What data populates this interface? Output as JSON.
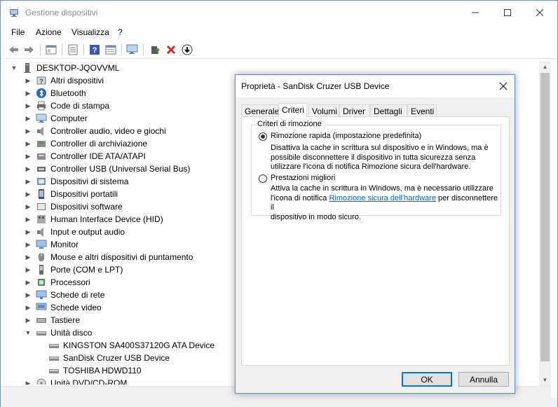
{
  "window": {
    "title": "Gestione dispositivi"
  },
  "menu": [
    "File",
    "Azione",
    "Visualizza",
    "?"
  ],
  "tree": {
    "root": "DESKTOP-JQOVVML",
    "categories": [
      "Altri dispositivi",
      "Bluetooth",
      "Code di stampa",
      "Computer",
      "Controller audio, video e giochi",
      "Controller di archiviazione",
      "Controller IDE ATA/ATAPI",
      "Controller USB (Universal Serial Bus)",
      "Dispositivi di sistema",
      "Dispositivi portatili",
      "Dispositivi software",
      "Human Interface Device (HID)",
      "Input e output audio",
      "Monitor",
      "Mouse e altri dispositivi di puntamento",
      "Porte (COM e LPT)",
      "Processori",
      "Schede di rete",
      "Schede video",
      "Tastiere",
      "Unità disco"
    ],
    "disks": [
      "KINGSTON SA400S37120G ATA Device",
      "SanDisk Cruzer USB Device",
      "TOSHIBA HDWD110"
    ],
    "last": "Unità DVD/CD-ROM"
  },
  "dialog": {
    "title": "Proprietà - SanDisk Cruzer USB Device",
    "tabs": [
      "Generale",
      "Criteri",
      "Volumi",
      "Driver",
      "Dettagli",
      "Eventi"
    ],
    "active_tab": "Criteri",
    "group_title": "Criteri di rimozione",
    "option1": {
      "label": "Rimozione rapida (impostazione predefinita)",
      "desc1": "Disattiva la cache in scrittura sul dispositivo e in Windows, ma è",
      "desc2": "possibile disconnettere il dispositivo in tutta sicurezza senza",
      "desc3": "utilizzare l'icona di notifica Rimozione sicura dell'hardware."
    },
    "option2": {
      "label": "Prestazioni migliori",
      "desc1": "Attiva la cache in scrittura in Windows, ma è necessario utilizzare",
      "desc2a": "l'icona di notifica ",
      "desc2link": "Rimozione sicura dell'hardware",
      "desc2b": " per disconnettere il",
      "desc3": "dispositivo in modo sicuro."
    },
    "ok": "OK",
    "cancel": "Annulla"
  }
}
